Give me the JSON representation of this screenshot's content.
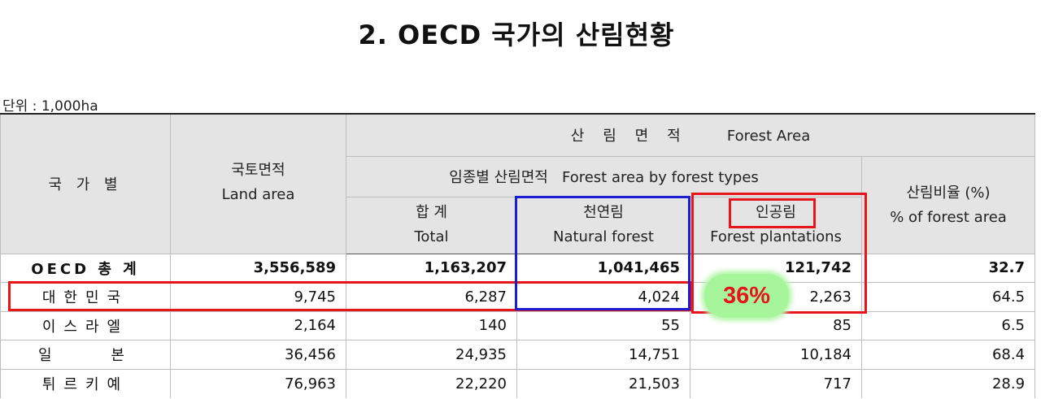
{
  "title": "2.  OECD 국가의 산림현황",
  "unit": "단위 : 1,000ha",
  "headers": {
    "country": "국 가 별",
    "land_ko": "국토면적",
    "land_en": "Land area",
    "forest_area": "산    림    면    적          Forest Area",
    "by_type": "임종별 산림면적   Forest area by forest types",
    "ratio_ko": "산림비율 (%)",
    "ratio_en": "% of forest area",
    "total_ko": "합  계",
    "total_en": "Total",
    "natural_ko": "천연림",
    "natural_en": "Natural forest",
    "plant_ko": "인공림",
    "plant_en": "Forest plantations"
  },
  "rows": [
    {
      "country": "OECD 총 계",
      "land": "3,556,589",
      "total": "1,163,207",
      "natural": "1,041,465",
      "plantation": "121,742",
      "ratio": "32.7"
    },
    {
      "country": "대한민국",
      "land": "9,745",
      "total": "6,287",
      "natural": "4,024",
      "plantation": "2,263",
      "ratio": "64.5"
    },
    {
      "country": "이스라엘",
      "land": "2,164",
      "total": "140",
      "natural": "55",
      "plantation": "85",
      "ratio": "6.5"
    },
    {
      "country": "일    본",
      "land": "36,456",
      "total": "24,935",
      "natural": "14,751",
      "plantation": "10,184",
      "ratio": "68.4"
    },
    {
      "country": "튀르키예",
      "land": "76,963",
      "total": "22,220",
      "natural": "21,503",
      "plantation": "717",
      "ratio": "28.9"
    }
  ],
  "annotation": {
    "badge": "36%",
    "colors": {
      "highlight": "#e8141b",
      "natural": "#1c1cd0",
      "badge_bg": "#a6f59a"
    }
  }
}
